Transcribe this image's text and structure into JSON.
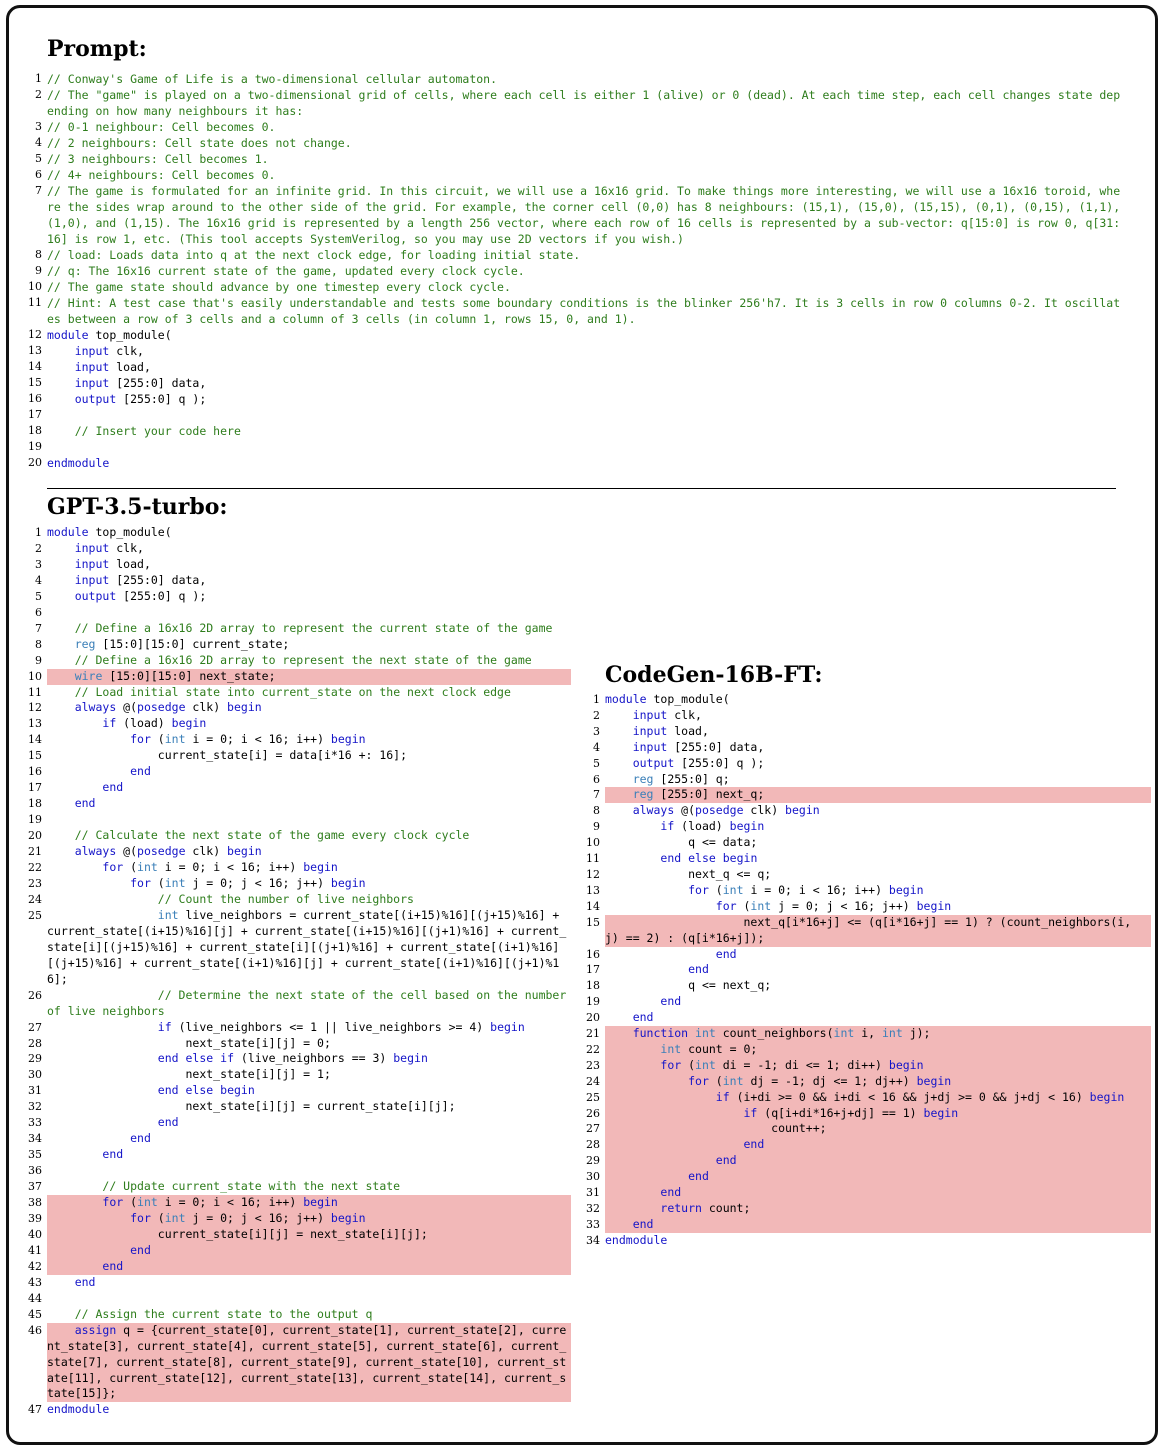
{
  "headings": {
    "prompt": "Prompt:",
    "gpt": "GPT-3.5-turbo:",
    "codegen": "CodeGen-16B-FT:"
  },
  "prompt": [
    {
      "n": "1",
      "t": "// Conway's Game of Life is a two-dimensional cellular automaton."
    },
    {
      "n": "2",
      "t": "// The \"game\" is played on a two-dimensional grid of cells, where each cell is either 1 (alive) or 0 (dead). At each time step, each cell changes state depending on how many neighbours it has:"
    },
    {
      "n": "3",
      "t": "// 0-1 neighbour: Cell becomes 0."
    },
    {
      "n": "4",
      "t": "// 2 neighbours: Cell state does not change."
    },
    {
      "n": "5",
      "t": "// 3 neighbours: Cell becomes 1."
    },
    {
      "n": "6",
      "t": "// 4+ neighbours: Cell becomes 0."
    },
    {
      "n": "7",
      "t": "// The game is formulated for an infinite grid. In this circuit, we will use a 16x16 grid. To make things more interesting, we will use a 16x16 toroid, where the sides wrap around to the other side of the grid. For example, the corner cell (0,0) has 8 neighbours: (15,1), (15,0), (15,15), (0,1), (0,15), (1,1), (1,0), and (1,15). The 16x16 grid is represented by a length 256 vector, where each row of 16 cells is represented by a sub-vector: q[15:0] is row 0, q[31:16] is row 1, etc. (This tool accepts SystemVerilog, so you may use 2D vectors if you wish.)"
    },
    {
      "n": "8",
      "t": "// load: Loads data into q at the next clock edge, for loading initial state."
    },
    {
      "n": "9",
      "t": "// q: The 16x16 current state of the game, updated every clock cycle."
    },
    {
      "n": "10",
      "t": "// The game state should advance by one timestep every clock cycle."
    },
    {
      "n": "11",
      "t": "// Hint: A test case that's easily understandable and tests some boundary conditions is the blinker 256'h7. It is 3 cells in row 0 columns 0-2. It oscillates between a row of 3 cells and a column of 3 cells (in column 1, rows 15, 0, and 1)."
    },
    {
      "n": "12",
      "t": "module top_module("
    },
    {
      "n": "13",
      "t": "    input clk,"
    },
    {
      "n": "14",
      "t": "    input load,"
    },
    {
      "n": "15",
      "t": "    input [255:0] data,"
    },
    {
      "n": "16",
      "t": "    output [255:0] q );"
    },
    {
      "n": "17",
      "t": ""
    },
    {
      "n": "18",
      "t": "    // Insert your code here"
    },
    {
      "n": "19",
      "t": ""
    },
    {
      "n": "20",
      "t": "endmodule"
    }
  ],
  "gpt": [
    {
      "n": "1",
      "t": "module top_module("
    },
    {
      "n": "2",
      "t": "    input clk,"
    },
    {
      "n": "3",
      "t": "    input load,"
    },
    {
      "n": "4",
      "t": "    input [255:0] data,"
    },
    {
      "n": "5",
      "t": "    output [255:0] q );"
    },
    {
      "n": "6",
      "t": ""
    },
    {
      "n": "7",
      "t": "    // Define a 16x16 2D array to represent the current state of the game"
    },
    {
      "n": "8",
      "t": "    reg [15:0][15:0] current_state;"
    },
    {
      "n": "9",
      "t": "    // Define a 16x16 2D array to represent the next state of the game"
    },
    {
      "n": "10",
      "t": "    wire [15:0][15:0] next_state;",
      "hl": true
    },
    {
      "n": "11",
      "t": "    // Load initial state into current_state on the next clock edge"
    },
    {
      "n": "12",
      "t": "    always @(posedge clk) begin"
    },
    {
      "n": "13",
      "t": "        if (load) begin"
    },
    {
      "n": "14",
      "t": "            for (int i = 0; i < 16; i++) begin"
    },
    {
      "n": "15",
      "t": "                current_state[i] = data[i*16 +: 16];"
    },
    {
      "n": "16",
      "t": "            end"
    },
    {
      "n": "17",
      "t": "        end"
    },
    {
      "n": "18",
      "t": "    end"
    },
    {
      "n": "19",
      "t": ""
    },
    {
      "n": "20",
      "t": "    // Calculate the next state of the game every clock cycle"
    },
    {
      "n": "21",
      "t": "    always @(posedge clk) begin"
    },
    {
      "n": "22",
      "t": "        for (int i = 0; i < 16; i++) begin"
    },
    {
      "n": "23",
      "t": "            for (int j = 0; j < 16; j++) begin"
    },
    {
      "n": "24",
      "t": "                // Count the number of live neighbors"
    },
    {
      "n": "25",
      "t": "                int live_neighbors = current_state[(i+15)%16][(j+15)%16] + current_state[(i+15)%16][j] + current_state[(i+15)%16][(j+1)%16] + current_state[i][(j+15)%16] + current_state[i][(j+1)%16] + current_state[(i+1)%16][(j+15)%16] + current_state[(i+1)%16][j] + current_state[(i+1)%16][(j+1)%16];"
    },
    {
      "n": "26",
      "t": "                // Determine the next state of the cell based on the number of live neighbors"
    },
    {
      "n": "27",
      "t": "                if (live_neighbors <= 1 || live_neighbors >= 4) begin"
    },
    {
      "n": "28",
      "t": "                    next_state[i][j] = 0;"
    },
    {
      "n": "29",
      "t": "                end else if (live_neighbors == 3) begin"
    },
    {
      "n": "30",
      "t": "                    next_state[i][j] = 1;"
    },
    {
      "n": "31",
      "t": "                end else begin"
    },
    {
      "n": "32",
      "t": "                    next_state[i][j] = current_state[i][j];"
    },
    {
      "n": "33",
      "t": "                end"
    },
    {
      "n": "34",
      "t": "            end"
    },
    {
      "n": "35",
      "t": "        end"
    },
    {
      "n": "36",
      "t": ""
    },
    {
      "n": "37",
      "t": "        // Update current_state with the next state"
    },
    {
      "n": "38",
      "t": "        for (int i = 0; i < 16; i++) begin",
      "hl": true
    },
    {
      "n": "39",
      "t": "            for (int j = 0; j < 16; j++) begin",
      "hl": true
    },
    {
      "n": "40",
      "t": "                current_state[i][j] = next_state[i][j];",
      "hl": true
    },
    {
      "n": "41",
      "t": "            end",
      "hl": true
    },
    {
      "n": "42",
      "t": "        end",
      "hl": true
    },
    {
      "n": "43",
      "t": "    end"
    },
    {
      "n": "44",
      "t": ""
    },
    {
      "n": "45",
      "t": "    // Assign the current state to the output q"
    },
    {
      "n": "46",
      "t": "    assign q = {current_state[0], current_state[1], current_state[2], current_state[3], current_state[4], current_state[5], current_state[6], current_state[7], current_state[8], current_state[9], current_state[10], current_state[11], current_state[12], current_state[13], current_state[14], current_state[15]};",
      "hl": true
    },
    {
      "n": "47",
      "t": "endmodule"
    }
  ],
  "codegen": [
    {
      "n": "1",
      "t": "module top_module("
    },
    {
      "n": "2",
      "t": "    input clk,"
    },
    {
      "n": "3",
      "t": "    input load,"
    },
    {
      "n": "4",
      "t": "    input [255:0] data,"
    },
    {
      "n": "5",
      "t": "    output [255:0] q );"
    },
    {
      "n": "6",
      "t": "    reg [255:0] q;"
    },
    {
      "n": "7",
      "t": "    reg [255:0] next_q;",
      "hl": true
    },
    {
      "n": "8",
      "t": "    always @(posedge clk) begin"
    },
    {
      "n": "9",
      "t": "        if (load) begin"
    },
    {
      "n": "10",
      "t": "            q <= data;"
    },
    {
      "n": "11",
      "t": "        end else begin"
    },
    {
      "n": "12",
      "t": "            next_q <= q;"
    },
    {
      "n": "13",
      "t": "            for (int i = 0; i < 16; i++) begin"
    },
    {
      "n": "14",
      "t": "                for (int j = 0; j < 16; j++) begin"
    },
    {
      "n": "15",
      "t": "                    next_q[i*16+j] <= (q[i*16+j] == 1) ? (count_neighbors(i, j) == 2) : (q[i*16+j]);",
      "hl": true
    },
    {
      "n": "16",
      "t": "                end"
    },
    {
      "n": "17",
      "t": "            end"
    },
    {
      "n": "18",
      "t": "            q <= next_q;"
    },
    {
      "n": "19",
      "t": "        end"
    },
    {
      "n": "20",
      "t": "    end"
    },
    {
      "n": "21",
      "t": "    function int count_neighbors(int i, int j);",
      "hl": true
    },
    {
      "n": "22",
      "t": "        int count = 0;",
      "hl": true
    },
    {
      "n": "23",
      "t": "        for (int di = -1; di <= 1; di++) begin",
      "hl": true
    },
    {
      "n": "24",
      "t": "            for (int dj = -1; dj <= 1; dj++) begin",
      "hl": true
    },
    {
      "n": "25",
      "t": "                if (i+di >= 0 && i+di < 16 && j+dj >= 0 && j+dj < 16) begin",
      "hl": true
    },
    {
      "n": "26",
      "t": "                    if (q[i+di*16+j+dj] == 1) begin",
      "hl": true
    },
    {
      "n": "27",
      "t": "                        count++;",
      "hl": true
    },
    {
      "n": "28",
      "t": "                    end",
      "hl": true
    },
    {
      "n": "29",
      "t": "                end",
      "hl": true
    },
    {
      "n": "30",
      "t": "            end",
      "hl": true
    },
    {
      "n": "31",
      "t": "        end",
      "hl": true
    },
    {
      "n": "32",
      "t": "        return count;",
      "hl": true
    },
    {
      "n": "33",
      "t": "    end",
      "hl": true
    },
    {
      "n": "34",
      "t": "endmodule"
    }
  ]
}
